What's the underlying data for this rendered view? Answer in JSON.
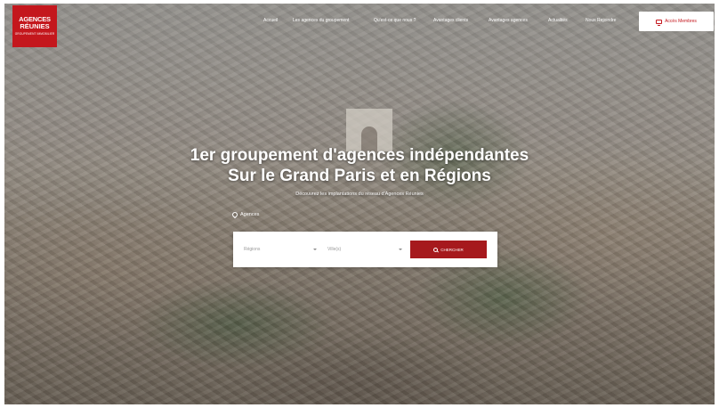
{
  "brand": {
    "logo_line1": "AGENCES",
    "logo_line2": "RÉUNIES",
    "logo_line3": "GROUPEMENT IMMOBILIER",
    "color": "#c4171d"
  },
  "nav": {
    "items": [
      "Accueil",
      "Les agences du groupement",
      "Qu'est-ce que nous ?",
      "Avantages clients",
      "Avantages agences",
      "Actualités",
      "Nous Rejoindre"
    ],
    "member_button": "Accès Membres"
  },
  "hero": {
    "title_line1": "1er groupement d'agences indépendantes",
    "title_line2": "Sur le Grand Paris et en Régions",
    "subtitle": "Découvrez les implantations du réseau d'Agences Réunies"
  },
  "search": {
    "tab_label": "Agences",
    "tab_icon": "map-pin-icon",
    "region_placeholder": "Régions",
    "city_placeholder": "Ville(s)",
    "button_label": "Chercher",
    "button_color": "#a6191d"
  }
}
